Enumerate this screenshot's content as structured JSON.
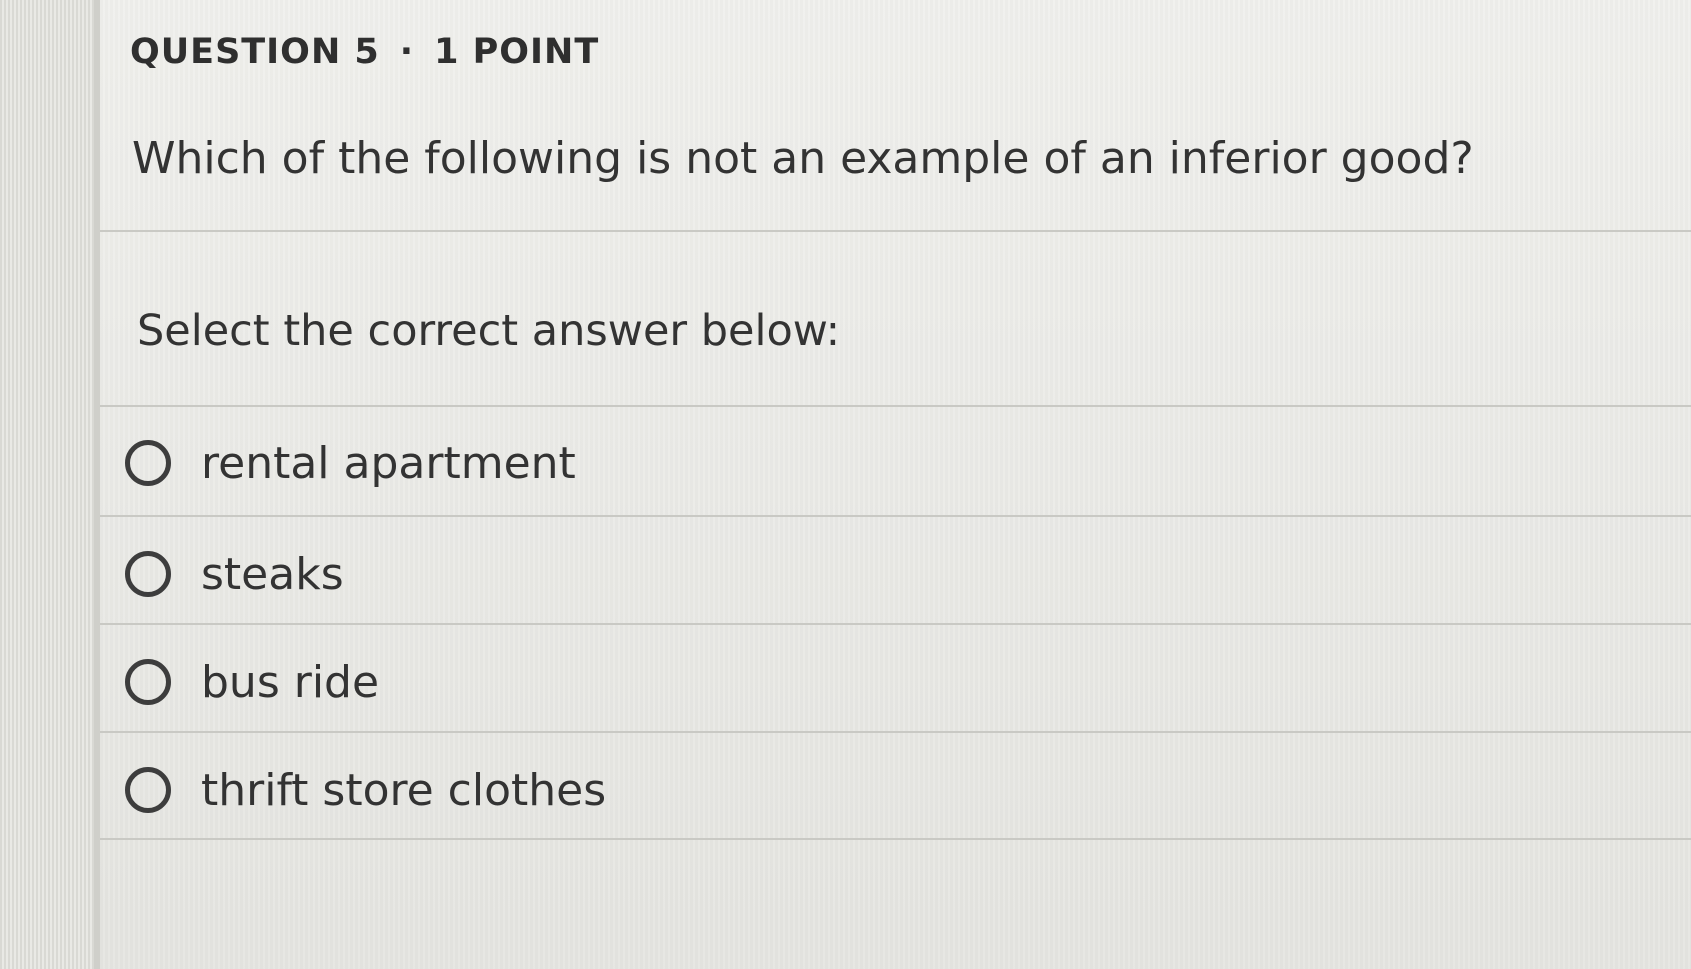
{
  "header": {
    "question_number": "QUESTION 5",
    "separator": "·",
    "points": "1 POINT"
  },
  "question": {
    "text": "Which of the following is not an example of an inferior good?"
  },
  "prompt": "Select the correct answer below:",
  "options": [
    {
      "label": "rental apartment",
      "selected": false
    },
    {
      "label": "steaks",
      "selected": false
    },
    {
      "label": "bus ride",
      "selected": false
    },
    {
      "label": "thrift store clothes",
      "selected": false
    }
  ]
}
